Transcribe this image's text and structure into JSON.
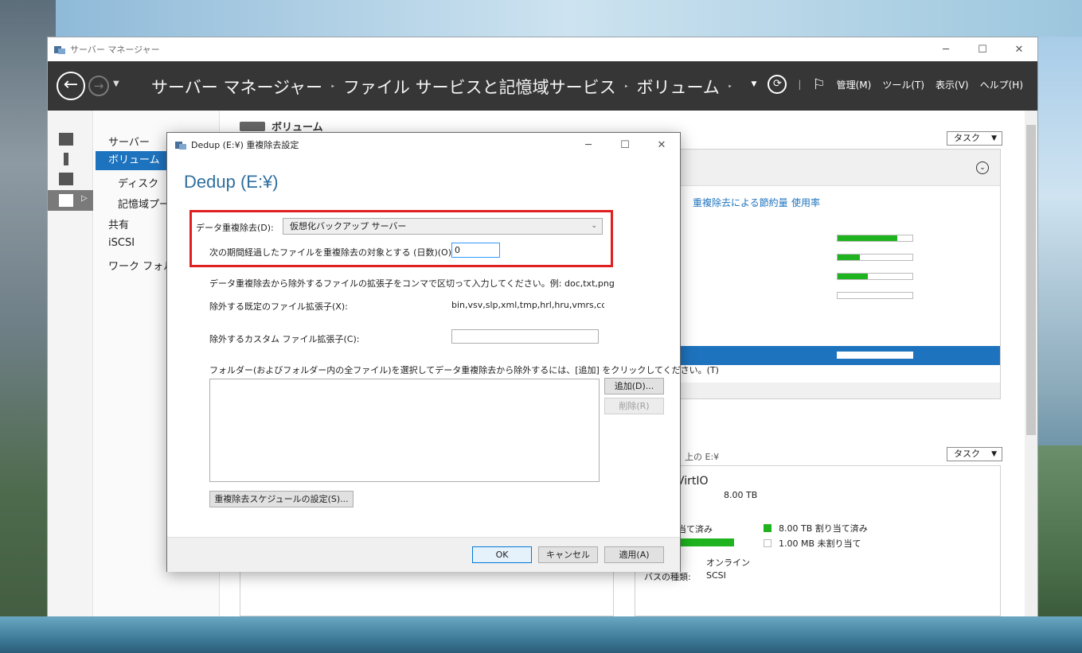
{
  "window": {
    "title": "サーバー マネージャー",
    "controls": {
      "minimize": "─",
      "maximize": "☐",
      "close": "✕"
    }
  },
  "header": {
    "breadcrumb": [
      "サーバー マネージャー",
      "ファイル サービスと記憶域サービス",
      "ボリューム"
    ],
    "sep": "‣",
    "menus": [
      "管理(M)",
      "ツール(T)",
      "表示(V)",
      "ヘルプ(H)"
    ]
  },
  "left_nav": {
    "items": [
      {
        "label": "サーバー"
      },
      {
        "label": "ボリューム"
      },
      {
        "label": "ディスク"
      },
      {
        "label": "記憶域プー"
      },
      {
        "label": "共有"
      },
      {
        "label": "iSCSI"
      },
      {
        "label": "ワーク フォルダ"
      }
    ]
  },
  "main": {
    "panel_title": "ボリューム",
    "task_label": "タスク",
    "columns": [
      "重複除去による節約量",
      "使用率"
    ],
    "usage": [
      0.8,
      0.3,
      0.4,
      0.0,
      0.0
    ],
    "lower": {
      "title": "上の E:¥",
      "disk_name": "t VirtIO",
      "capacity": "8.00 TB",
      "allocated_label": "り当て済み",
      "legend_allocated": "8.00 TB 割り当て済み",
      "legend_unallocated": "1.00 MB 未割り当て",
      "status_value": "オンライン",
      "bus_label": "バスの種類:",
      "bus_value": "SCSI"
    }
  },
  "dialog": {
    "title": "Dedup (E:¥) 重複除去設定",
    "heading": "Dedup (E:¥)",
    "dedup_label": "データ重複除去(D):",
    "dedup_value": "仮想化バックアップ サーバー",
    "days_label": "次の期間経過したファイルを重複除去の対象とする (日数)(O):",
    "days_value": "0",
    "ext_instruction": "データ重複除去から除外するファイルの拡張子をコンマで区切って入力してください。例: doc,txt,png",
    "default_ext_label": "除外する既定のファイル拡張子(X):",
    "default_ext_value": "bin,vsv,slp,xml,tmp,hrl,hru,vmrs,cdp,v",
    "custom_ext_label": "除外するカスタム ファイル拡張子(C):",
    "folder_instruction": "フォルダー(およびフォルダー内の全ファイル)を選択してデータ重複除去から除外するには、[追加] をクリックしてください。(T)",
    "add_button": "追加(D)...",
    "remove_button": "削除(R)",
    "schedule_button": "重複除去スケジュールの設定(S)...",
    "ok_button": "OK",
    "cancel_button": "キャンセル",
    "apply_button": "適用(A)"
  }
}
